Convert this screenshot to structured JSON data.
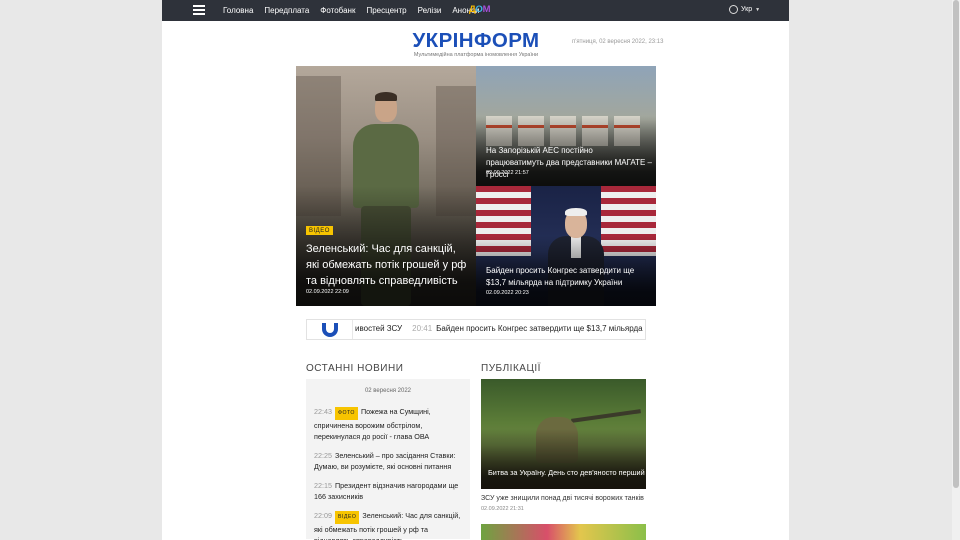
{
  "nav": {
    "links": [
      "Головна",
      "Передплата",
      "Фотобанк",
      "Пресцентр",
      "Релізи",
      "Анонси"
    ],
    "dom_logo": {
      "d": "Д",
      "o": "О",
      "m": "М"
    },
    "lang": "Укр"
  },
  "header": {
    "logo_text": "УКРІНФОРМ",
    "tagline": "Мультимедійна платформа іномовлення України",
    "dateline": "п'ятниця, 02 вересня 2022, 23:13"
  },
  "hero": {
    "main": {
      "badge": "ВІДЕО",
      "headline": "Зеленський: Час для санкцій, які обмежать потік грошей у рф та відновлять справедливість",
      "time": "02.09.2022 22:09"
    },
    "side": [
      {
        "headline": "На Запорізькій АЕС постійно працюватимуть два представники МАГАТЕ – Гроссі",
        "time": "02.09.2022 21:57"
      },
      {
        "headline": "Байден просить Конгрес затвердити ще $13,7 мільярда на підтримку України",
        "time": "02.09.2022 20:23"
      }
    ]
  },
  "ticker": {
    "prev_tail": "ивостей ЗСУ",
    "time": "20:41",
    "text": "Байден просить Конгрес затвердити ще $13,7 мільярда на підтрим"
  },
  "latest": {
    "title": "ОСТАННІ НОВИНИ",
    "date": "02 вересня 2022",
    "items": [
      {
        "time": "22:43",
        "badge": "ФОТО",
        "text": "Пожежа на Сумщині, спричинена ворожим обстрілом, перекинулася до росії - глава ОВА"
      },
      {
        "time": "22:25",
        "badge": "",
        "text": "Зеленський – про засідання Ставки: Думаю, ви розумієте, які основні питання"
      },
      {
        "time": "22:15",
        "badge": "",
        "text": "Президент відзначив нагородами ще 166 захисників"
      },
      {
        "time": "22:09",
        "badge": "ВІДЕО",
        "text": "Зеленський: Час для санкцій, які обмежать потік грошей у рф та відновлять справедливість"
      }
    ]
  },
  "publications": {
    "title": "ПУБЛІКАЦІЇ",
    "caption": "Битва за Україну. День сто дев'яносто перший",
    "sub": "ЗСУ уже знищили понад дві тисячі ворожих танків",
    "time": "02.09.2022 21:31"
  }
}
